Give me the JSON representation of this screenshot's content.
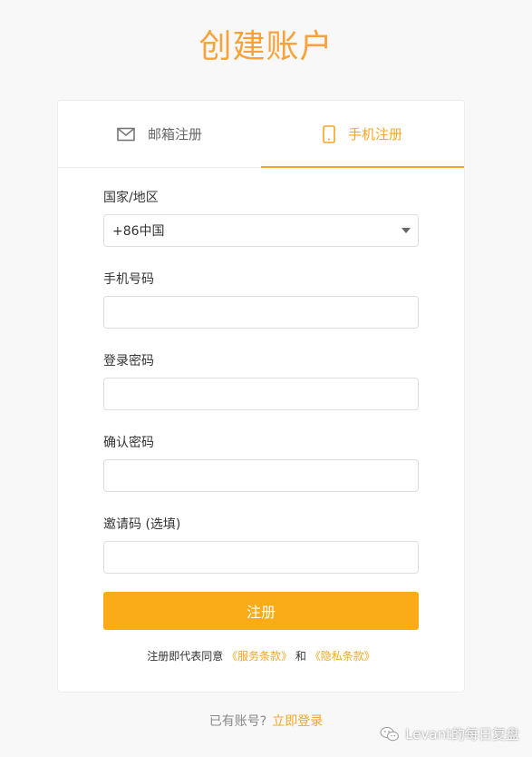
{
  "header": {
    "title": "创建账户"
  },
  "tabs": [
    {
      "label": "邮箱注册",
      "icon": "mail-icon",
      "active": false
    },
    {
      "label": "手机注册",
      "icon": "mobile-phone-icon",
      "active": true
    }
  ],
  "form": {
    "country": {
      "label": "国家/地区",
      "value": "+86中国"
    },
    "phone": {
      "label": "手机号码",
      "value": "",
      "placeholder": ""
    },
    "password": {
      "label": "登录密码",
      "value": "",
      "placeholder": ""
    },
    "confirm": {
      "label": "确认密码",
      "value": "",
      "placeholder": ""
    },
    "invite": {
      "label": "邀请码 (选填)",
      "value": "",
      "placeholder": ""
    },
    "submit_label": "注册"
  },
  "agreement": {
    "prefix": "注册即代表同意",
    "terms": "《服务条款》",
    "and": "和",
    "privacy": "《隐私条款》"
  },
  "footer": {
    "has_account": "已有账号?",
    "login_link": "立即登录"
  },
  "watermark": {
    "text": "Levant的每日复盘"
  },
  "colors": {
    "accent": "#f5a623",
    "button": "#faab18",
    "background": "#f8f8f8"
  }
}
